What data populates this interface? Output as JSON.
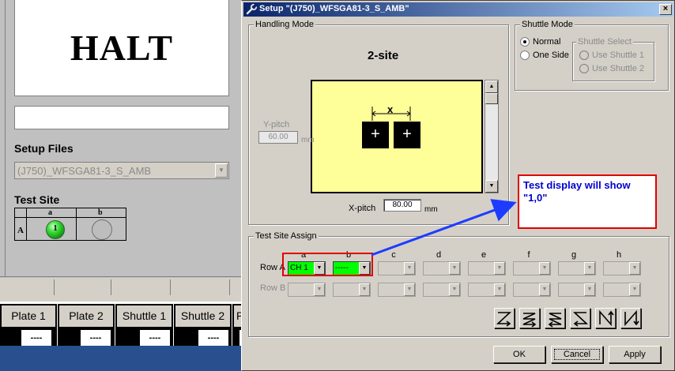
{
  "left_app": {
    "halt_text": "HALT",
    "setup_files_label": "Setup Files",
    "setup_file_value": "(J750)_WFSGA81-3_S_AMB",
    "test_site_label": "Test Site",
    "site_table": {
      "columns": [
        "a",
        "b"
      ],
      "row": "A",
      "site_a_value": "1"
    },
    "status_cells": [
      {
        "title": "Plate 1",
        "value": "----"
      },
      {
        "title": "Plate 2",
        "value": "----"
      },
      {
        "title": "Shuttle 1",
        "value": "----"
      },
      {
        "title": "Shuttle 2",
        "value": "----"
      },
      {
        "title": "P",
        "value": "----"
      }
    ]
  },
  "dialog": {
    "title": "Setup \"(J750)_WFSGA81-3_S_AMB\"",
    "close_label": "×",
    "handling_mode": {
      "label": "Handling Mode",
      "mode_title": "2-site",
      "dimension_label": "x",
      "site_symbol": "+",
      "ypitch_label": "Y-pitch",
      "ypitch_value": "60.00",
      "xpitch_label": "X-pitch",
      "xpitch_value": "80.00",
      "unit": "mm"
    },
    "shuttle_mode": {
      "label": "Shuttle Mode",
      "options": [
        "Normal",
        "One Side"
      ],
      "selected": "Normal",
      "shuttle_select": {
        "label": "Shuttle Select",
        "options": [
          "Use Shuttle 1",
          "Use Shuttle 2"
        ]
      }
    },
    "test_site_assign": {
      "label": "Test Site Assign",
      "columns": [
        "a",
        "b",
        "c",
        "d",
        "e",
        "f",
        "g",
        "h"
      ],
      "rows": [
        "Row A",
        "Row B"
      ],
      "row_a_values": [
        "CH 1",
        "-----"
      ]
    },
    "buttons": {
      "ok": "OK",
      "cancel": "Cancel",
      "apply": "Apply"
    }
  },
  "annotation": {
    "text": "Test display will show \"1,0\"",
    "colors": {
      "border": "#e00000",
      "text": "#0000cc",
      "arrow": "#1e3cff"
    }
  },
  "colors": {
    "title_bar": "#0a246a",
    "preview_bg": "#ffff99",
    "active_combo": "#00ff00"
  }
}
